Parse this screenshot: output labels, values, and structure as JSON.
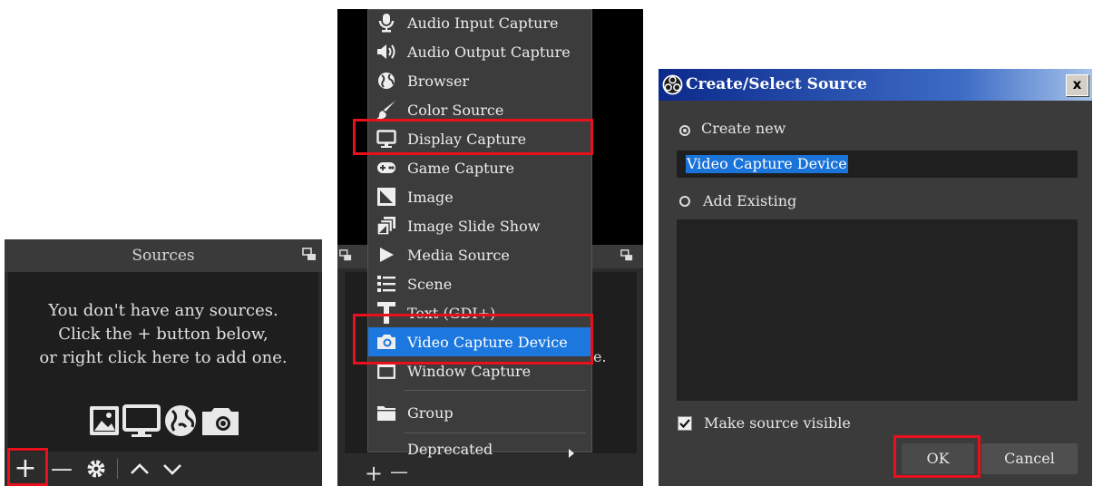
{
  "sources_panel": {
    "title": "Sources",
    "empty_message": [
      "You don't have any sources.",
      "Click the + button below,",
      "or right click here to add one."
    ],
    "toolbar": {
      "add": "+",
      "remove": "—"
    }
  },
  "source_menu": {
    "items": [
      {
        "label": "Audio Input Capture",
        "icon": "microphone-icon"
      },
      {
        "label": "Audio Output Capture",
        "icon": "speaker-icon"
      },
      {
        "label": "Browser",
        "icon": "globe-icon"
      },
      {
        "label": "Color Source",
        "icon": "brush-icon"
      },
      {
        "label": "Display Capture",
        "icon": "monitor-icon"
      },
      {
        "label": "Game Capture",
        "icon": "gamepad-icon"
      },
      {
        "label": "Image",
        "icon": "image-icon"
      },
      {
        "label": "Image Slide Show",
        "icon": "slideshow-icon"
      },
      {
        "label": "Media Source",
        "icon": "play-icon"
      },
      {
        "label": "Scene",
        "icon": "list-icon"
      },
      {
        "label": "Text (GDI+)",
        "icon": "text-icon"
      },
      {
        "label": "Video Capture Device",
        "icon": "camera-icon"
      },
      {
        "label": "Window Capture",
        "icon": "window-icon"
      },
      {
        "label": "Group",
        "icon": "folder-icon"
      },
      {
        "label": "Deprecated",
        "icon": ""
      }
    ],
    "selected": "Video Capture Device",
    "background_fragments": {
      "stray_char": "e.",
      "add": "+",
      "remove": "—"
    }
  },
  "dialog": {
    "title": "Create/Select Source",
    "close": "x",
    "create_new_label": "Create new",
    "name_value": "Video Capture Device",
    "add_existing_label": "Add Existing",
    "make_visible_label": "Make source visible",
    "ok_label": "OK",
    "cancel_label": "Cancel"
  },
  "colors": {
    "highlight": "#e8111b",
    "selection": "#1c77de",
    "panel": "#2b2b2b",
    "title_blue": "#0b2a8c"
  }
}
